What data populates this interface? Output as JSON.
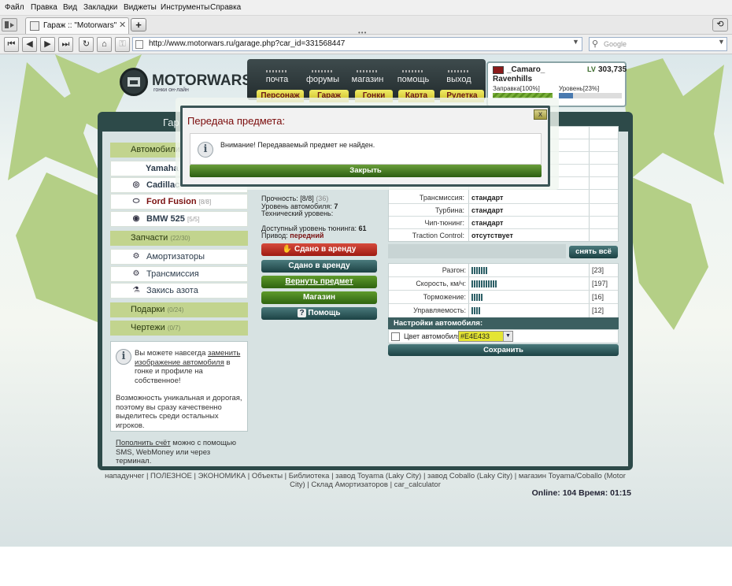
{
  "browser": {
    "menu": [
      "Файл",
      "Правка",
      "Вид",
      "Закладки",
      "Виджеты",
      "Инструменты",
      "Справка"
    ],
    "tab_title": "Гараж :: \"Motorwars\"",
    "url": "http://www.motorwars.ru/garage.php?car_id=331568447",
    "search_placeholder": "Google"
  },
  "site": {
    "logo": "MOTORWARS.RU",
    "tagline": "гонки он-лайн",
    "nav": [
      "почта",
      "форумы",
      "магазин",
      "помощь",
      "выход"
    ],
    "tabs": [
      "Персонаж",
      "Гараж",
      "Гонки",
      "Карта",
      "Рулетка"
    ],
    "player": {
      "name": "_Camaro_",
      "team": "Ravenhills",
      "lv": "LV",
      "money": "303,735",
      "fuel_label": "Заправка[100%]",
      "fuel": 1.0,
      "level_label": "Уровень[23%]",
      "level": 0.23
    }
  },
  "garage": {
    "title": "Гар",
    "sections": {
      "cars": "Автомобили",
      "parts": "Запчасти",
      "parts_count": "(22/30)",
      "gifts": "Подарки",
      "gifts_count": "(0/24)",
      "blueprints": "Чертежи",
      "blueprints_count": "(0/7)"
    },
    "cars": [
      {
        "name": "Yamaha",
        "count": ""
      },
      {
        "name": "Cadillac",
        "count": ""
      },
      {
        "name": "Ford Fusion",
        "count": "[8/8]"
      },
      {
        "name": "BMW 525",
        "count": "[5/5]"
      }
    ],
    "parts": [
      "Амортизаторы",
      "Трансмиссия",
      "Закись азота"
    ],
    "car_info": {
      "durability_label": "Прочность:",
      "durability": "[8/8]",
      "durability_extra": "(36)",
      "level_label": "Уровень автомобиля:",
      "level": "7",
      "tech_label": "Технический уровень:",
      "tuning_label": "Доступный уровень тюнинга:",
      "tuning": "61",
      "drive_label": "Привод:",
      "drive": "передний"
    },
    "buttons": {
      "rent_out": "Сдано в аренду",
      "rented": "Сдано в аренду",
      "return": "Вернуть предмет",
      "shop": "Магазин",
      "help": "Помощь"
    },
    "specs": [
      {
        "label": "Трансмиссия:",
        "value": "стандарт"
      },
      {
        "label": "Турбина:",
        "value": "стандарт"
      },
      {
        "label": "Чип-тюнинг:",
        "value": "стандарт"
      },
      {
        "label": "Traction Control:",
        "value": "отсутствует"
      }
    ],
    "remove_all": "снять всё",
    "stats": [
      {
        "label": "Разгон:",
        "value": "[23]",
        "v": 23
      },
      {
        "label": "Скорость, км/ч:",
        "value": "[197]",
        "v": 197
      },
      {
        "label": "Торможение:",
        "value": "[16]",
        "v": 16
      },
      {
        "label": "Управляемость:",
        "value": "[12]",
        "v": 12
      }
    ],
    "settings_title": "Настройки автомобиля:",
    "color_label": "Цвет автомобиля:",
    "color_value": "#E4E433",
    "save": "Сохранить",
    "info": {
      "p1a": "Вы можете навсегда ",
      "link1": "заменить изображение автомобиля",
      "p1b": " в гонке и профиле на собственное!",
      "p2": "Возможность уникальная и дорогая, поэтому вы сразу качественно выделитесь среди остальных игроков.",
      "link2": "Пополнить счёт",
      "p3": " можно с помощью SMS, WebMoney или через терминал."
    }
  },
  "footer": {
    "links": "нападунчег | ПОЛЕЗНОЕ | ЭКОНОМИКА | Объекты | Библиотека | завод Toyama (Laky City) | завод Coballo (Laky City) | магазин Toyama/Coballo (Motor City) | Склад Амортизаторов | car_calculator",
    "online": "Online: 104  Время: 01:15"
  },
  "dialog": {
    "title": "Передача предмета:",
    "message": "Внимание! Передаваемый предмет не найден.",
    "button": "Закрыть",
    "close": "x"
  }
}
